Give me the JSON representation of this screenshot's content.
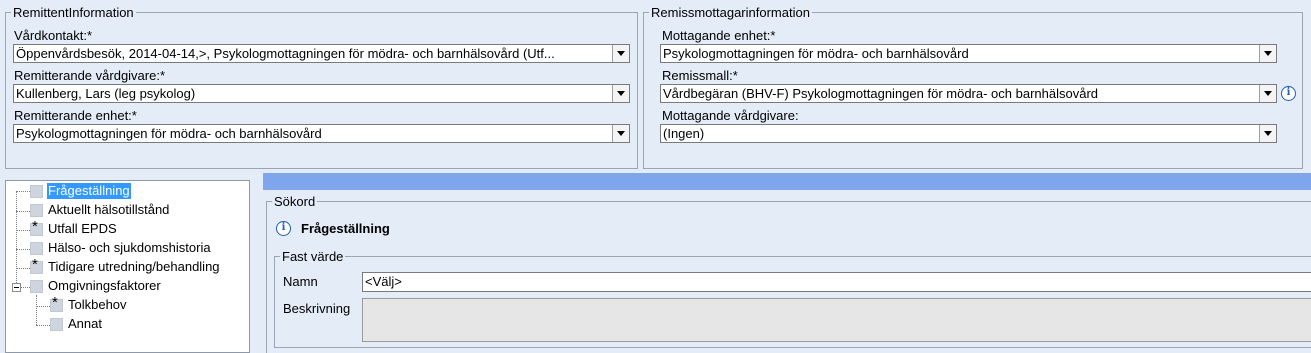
{
  "remittent": {
    "legend": "RemittentInformation",
    "vardkontakt_label": "Vårdkontakt:*",
    "vardkontakt_value": "Öppenvårdsbesök, 2014-04-14,>, Psykologmottagningen för mödra- och barnhälsovård (Utf...",
    "vardgivare_label": "Remitterande vårdgivare:*",
    "vardgivare_value": "Kullenberg, Lars (leg psykolog)",
    "enhet_label": "Remitterande enhet:*",
    "enhet_value": "Psykologmottagningen för mödra- och barnhälsovård"
  },
  "remissmottagare": {
    "legend": "Remissmottagarinformation",
    "mottagande_enhet_label": "Mottagande enhet:*",
    "mottagande_enhet_value": "Psykologmottagningen för mödra- och barnhälsovård",
    "remissmall_label": "Remissmall:*",
    "remissmall_value": "Vårdbegäran (BHV-F) Psykologmottagningen för mödra- och barnhälsovård",
    "mottagande_vardgivare_label": "Mottagande vårdgivare:",
    "mottagande_vardgivare_value": "(Ingen)"
  },
  "tree": {
    "items": [
      {
        "label": "Frågeställning",
        "star": "",
        "selected": true
      },
      {
        "label": "Aktuellt hälsotillstånd",
        "star": ""
      },
      {
        "label": "Utfall EPDS",
        "star": "*"
      },
      {
        "label": "Hälso- och sjukdomshistoria",
        "star": ""
      },
      {
        "label": "Tidigare utredning/behandling",
        "star": "*"
      },
      {
        "label": "Omgivningsfaktorer",
        "star": ""
      },
      {
        "label": "Tolkbehov",
        "star": "*"
      },
      {
        "label": "Annat",
        "star": ""
      }
    ]
  },
  "sokord": {
    "legend": "Sökord",
    "info_glyph": "i",
    "heading": "Frågeställning",
    "fast_varde_legend": "Fast värde",
    "namn_label": "Namn",
    "namn_value": "<Välj>",
    "beskrivning_label": "Beskrivning"
  },
  "colors": {
    "background": "#e4ecf7",
    "selection": "#3399ff",
    "bar": "#7fa6ec",
    "info_icon": "#1e5fb4"
  }
}
